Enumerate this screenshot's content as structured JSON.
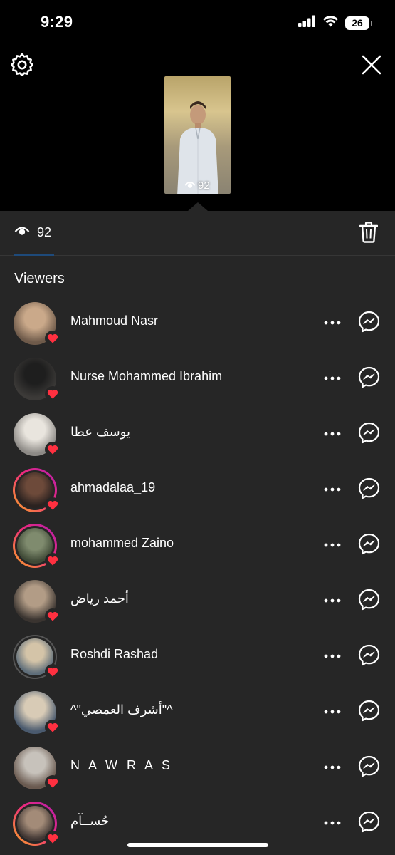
{
  "status_bar": {
    "time": "9:29",
    "battery": "26"
  },
  "story": {
    "view_count": "92"
  },
  "sheet": {
    "views_count": "92",
    "section_title": "Viewers"
  },
  "viewers": [
    {
      "name": "Mahmoud Nasr",
      "ring": "none",
      "avatar_colors": [
        "#caa98a",
        "#6e5a4a"
      ]
    },
    {
      "name": "Nurse Mohammed Ibrahim",
      "ring": "none",
      "avatar_colors": [
        "#1e1e1e",
        "#3c3a38"
      ]
    },
    {
      "name": "يوسف عطا",
      "ring": "none",
      "avatar_colors": [
        "#e9e5de",
        "#8d8a86"
      ]
    },
    {
      "name": "ahmadalaa_19",
      "ring": "story",
      "avatar_colors": [
        "#6d4a3a",
        "#2b2220"
      ]
    },
    {
      "name": "mohammed Zaino",
      "ring": "story",
      "avatar_colors": [
        "#7f8b6e",
        "#3f4936"
      ]
    },
    {
      "name": "أحمد رياض",
      "ring": "none",
      "avatar_colors": [
        "#b29c86",
        "#3a3430"
      ]
    },
    {
      "name": "Roshdi Rashad",
      "ring": "seen",
      "avatar_colors": [
        "#d4c4a8",
        "#5f6e7a"
      ]
    },
    {
      "name": "^\"أشرف العمصي\"^",
      "ring": "none",
      "avatar_colors": [
        "#d8cbb6",
        "#4a5a6e"
      ]
    },
    {
      "name": "N A W R A S",
      "ring": "none",
      "avatar_colors": [
        "#c7c2bb",
        "#6a5a50"
      ]
    },
    {
      "name": "حُســآم",
      "ring": "story",
      "avatar_colors": [
        "#a38b78",
        "#403633"
      ]
    }
  ]
}
